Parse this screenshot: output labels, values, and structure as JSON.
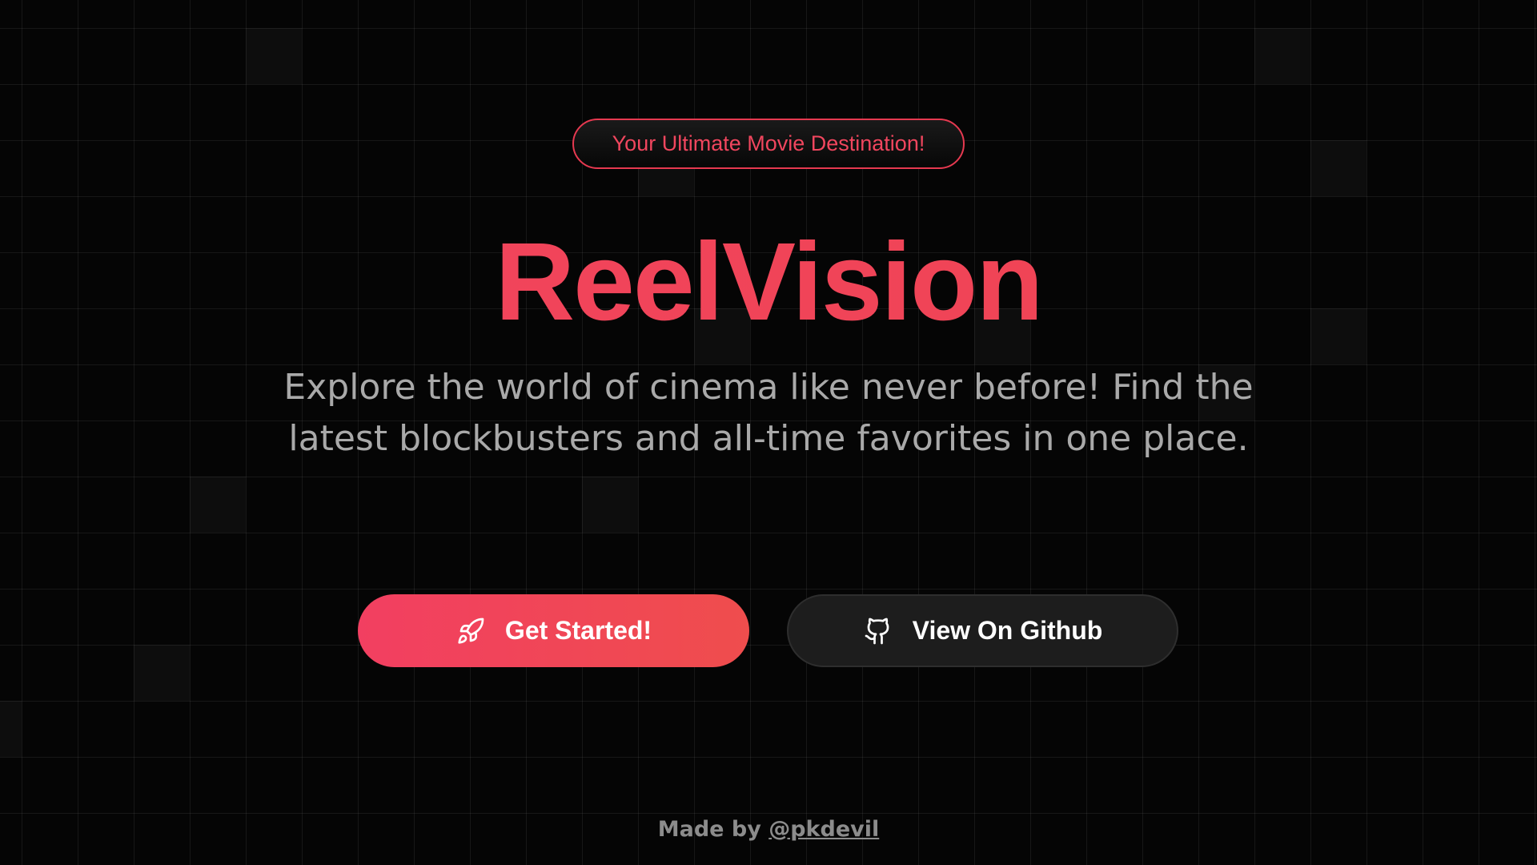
{
  "hero": {
    "badge_text": "Your Ultimate Movie Destination!",
    "title": "ReelVision",
    "subtitle": "Explore the world of cinema like never before! Find the latest blockbusters and all-time favorites in one place."
  },
  "actions": {
    "primary": {
      "label": "Get Started!",
      "icon": "rocket-icon"
    },
    "secondary": {
      "label": "View On Github",
      "icon": "github-icon"
    }
  },
  "footer": {
    "prefix": "Made by",
    "author_link": "@pkdevil"
  },
  "colors": {
    "accent": "#f0435d",
    "background": "#050505",
    "secondary_button": "#1d1d1d",
    "muted_text": "#a9a9a9"
  }
}
